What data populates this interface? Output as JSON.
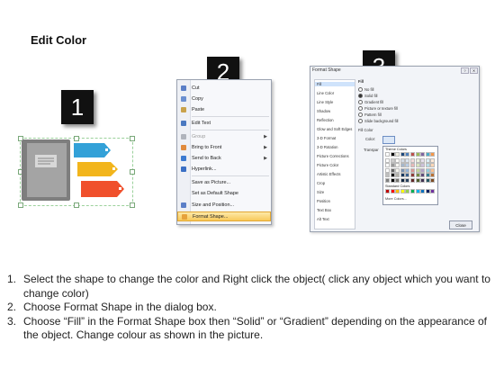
{
  "page": {
    "title": "Edit Color"
  },
  "badges": [
    "1",
    "2",
    "3"
  ],
  "context_menu": {
    "items": [
      {
        "label": "Cut",
        "icon": "scissors-icon",
        "icon_color": "#5b7fc7",
        "disabled": false,
        "submenu": false
      },
      {
        "label": "Copy",
        "icon": "copy-icon",
        "icon_color": "#6b8fd0",
        "disabled": false,
        "submenu": false
      },
      {
        "label": "Paste",
        "icon": "clipboard-icon",
        "icon_color": "#c9a24a",
        "disabled": false,
        "submenu": false
      },
      {
        "label": "Edit Text",
        "icon": "edit-text-icon",
        "icon_color": "#4a78c0",
        "disabled": false,
        "submenu": false
      },
      {
        "label": "Group",
        "icon": "group-icon",
        "icon_color": "#b0b4bc",
        "disabled": true,
        "submenu": true
      },
      {
        "label": "Bring to Front",
        "icon": "bring-front-icon",
        "icon_color": "#e08a3c",
        "disabled": false,
        "submenu": true
      },
      {
        "label": "Send to Back",
        "icon": "send-back-icon",
        "icon_color": "#3c7ad0",
        "disabled": false,
        "submenu": true
      },
      {
        "label": "Hyperlink...",
        "icon": "hyperlink-icon",
        "icon_color": "#3a6fc4",
        "disabled": false,
        "submenu": false
      },
      {
        "label": "Save as Picture...",
        "icon": "",
        "icon_color": "",
        "disabled": false,
        "submenu": false
      },
      {
        "label": "Set as Default Shape",
        "icon": "",
        "icon_color": "",
        "disabled": false,
        "submenu": false
      },
      {
        "label": "Size and Position...",
        "icon": "size-position-icon",
        "icon_color": "#5b7fc7",
        "disabled": false,
        "submenu": false
      },
      {
        "label": "Format Shape...",
        "icon": "format-shape-icon",
        "icon_color": "#e6a23c",
        "disabled": false,
        "submenu": false,
        "highlighted": true
      }
    ]
  },
  "format_dialog": {
    "title": "Format Shape",
    "categories": [
      "Fill",
      "Line Color",
      "Line Style",
      "Shadow",
      "Reflection",
      "Glow and Soft Edges",
      "3-D Format",
      "3-D Rotation",
      "Picture Corrections",
      "Picture Color",
      "Artistic Effects",
      "Crop",
      "Size",
      "Position",
      "Text Box",
      "Alt Text"
    ],
    "selected_category": "Fill",
    "panel_heading": "Fill",
    "fill_options": [
      "No fill",
      "Solid fill",
      "Gradient fill",
      "Picture or texture fill",
      "Pattern fill",
      "Slide background fill"
    ],
    "selected_option": "Solid fill",
    "fill_color_heading": "Fill Color",
    "color_label": "Color:",
    "transparency_label": "Transpar",
    "theme_colors_label": "Theme Colors",
    "standard_colors_label": "Standard Colors",
    "more_colors_label": "More Colors...",
    "close_label": "Close",
    "theme_top": [
      "#ffffff",
      "#000000",
      "#eeece1",
      "#1f497d",
      "#4f81bd",
      "#c0504d",
      "#9bbb59",
      "#8064a2",
      "#4bacc6",
      "#f79646"
    ],
    "standard_colors": [
      "#c00000",
      "#ff0000",
      "#ffc000",
      "#ffff00",
      "#92d050",
      "#00b050",
      "#00b0f0",
      "#0070c0",
      "#002060",
      "#7030a0"
    ]
  },
  "instructions": [
    {
      "num": "1.",
      "text": "Select the shape to change the color and Right click the object( click any object which you want to change color)"
    },
    {
      "num": "2.",
      "text": "Choose Format Shape in the dialog box."
    },
    {
      "num": "3.",
      "text": "Choose “Fill” in the Format Shape box then “Solid” or “Gradient” depending on the appearance of the object. Change colour as shown in the picture."
    }
  ],
  "colors": {
    "book": "#9a9a9a",
    "tab_blue": "#33a1d8",
    "tab_yellow": "#f2b51c",
    "tab_red": "#f0502c",
    "badge": "#111111",
    "menu_highlight": "#f8c95a"
  }
}
